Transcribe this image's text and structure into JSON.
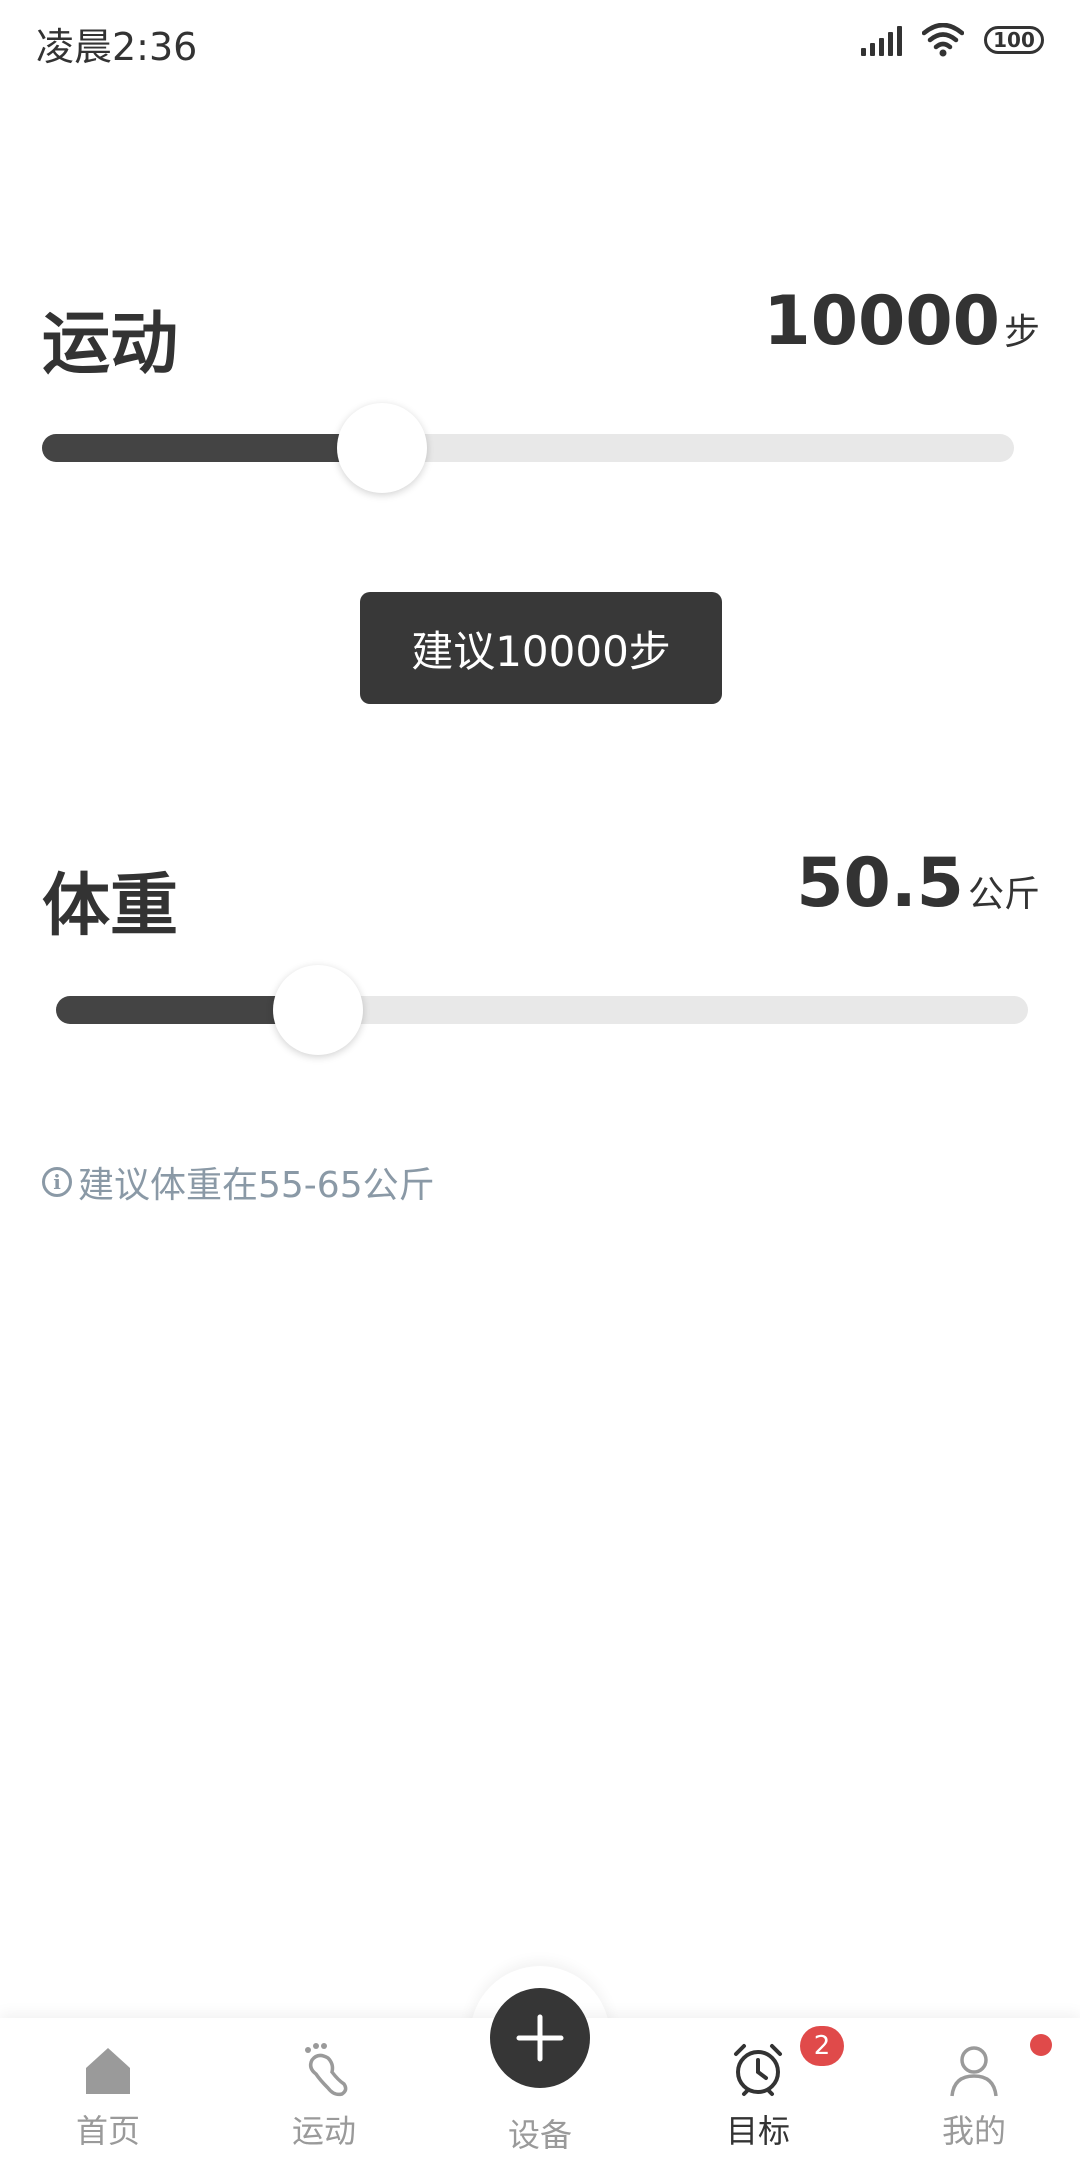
{
  "status_bar": {
    "time": "凌晨2:36",
    "battery": "100"
  },
  "exercise": {
    "title": "运动",
    "value": "10000",
    "unit": "步",
    "slider_level": 0.35,
    "tooltip": "建议10000步"
  },
  "weight": {
    "title": "体重",
    "value": "50.5",
    "unit": "公斤",
    "slider_level": 0.27,
    "hint": "建议体重在55-65公斤"
  },
  "nav": {
    "items": [
      {
        "label": "首页",
        "icon": "home-icon"
      },
      {
        "label": "运动",
        "icon": "footprint-icon"
      },
      {
        "label": "设备",
        "icon": "plus-icon"
      },
      {
        "label": "目标",
        "icon": "alarm-clock-icon"
      },
      {
        "label": "我的",
        "icon": "user-icon"
      }
    ],
    "active": "目标",
    "badge_count": "2"
  },
  "colors": {
    "accent": "#363636",
    "badge": "#e04a4a",
    "hint": "#8a99a6",
    "track": "#e8e8e8"
  }
}
